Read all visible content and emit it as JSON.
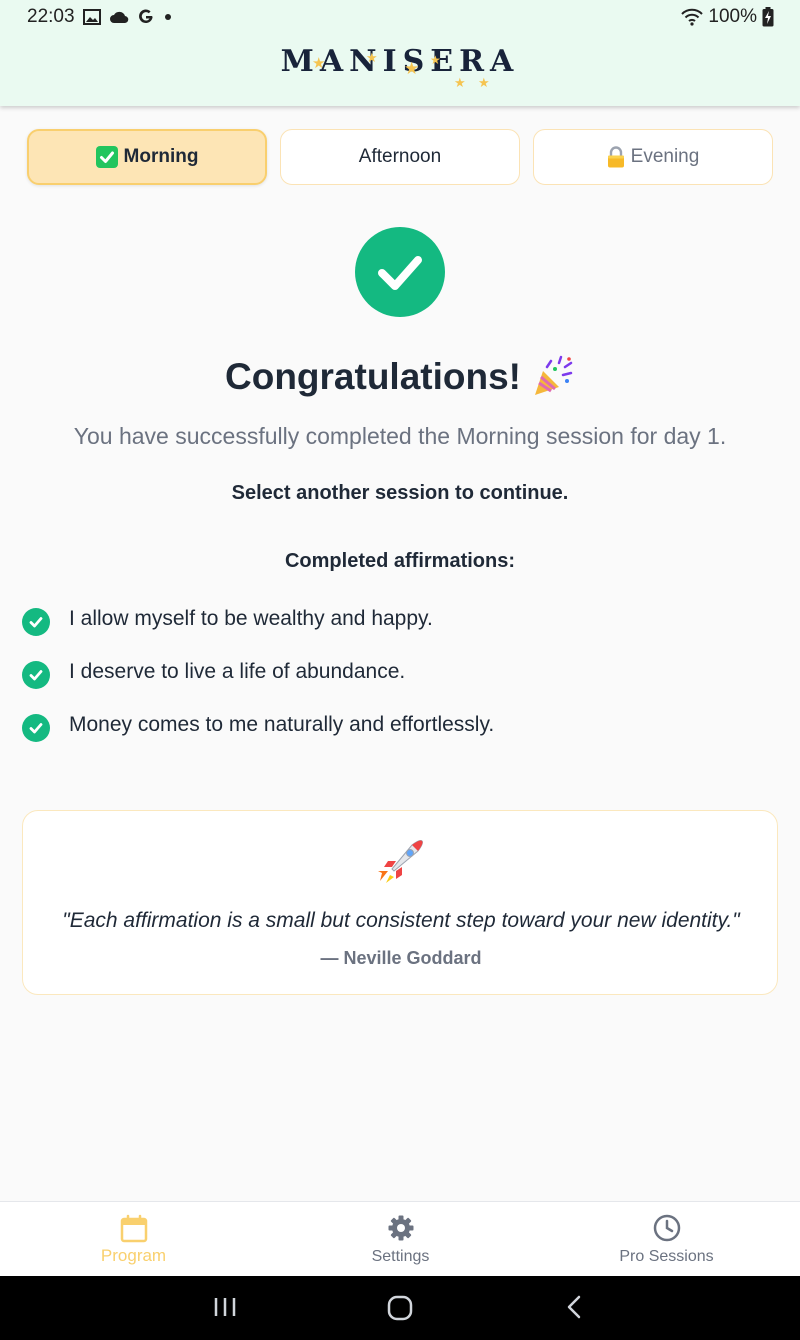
{
  "status_bar": {
    "time": "22:03",
    "battery": "100%"
  },
  "header": {
    "logo": "MANISERA"
  },
  "tabs": [
    {
      "label": "Morning",
      "state": "active",
      "icon": "check-box-icon"
    },
    {
      "label": "Afternoon",
      "state": "default"
    },
    {
      "label": "Evening",
      "state": "locked",
      "icon": "lock-icon"
    }
  ],
  "main": {
    "title": "Congratulations!",
    "title_icon": "party-popper-icon",
    "subtitle": "You have successfully completed the Morning session for day 1.",
    "select_message": "Select another session to continue.",
    "completed_title": "Completed affirmations:",
    "affirmations": [
      "I allow myself to be wealthy and happy.",
      "I deserve to live a life of abundance.",
      "Money comes to me naturally and effortlessly."
    ]
  },
  "quote": {
    "icon": "rocket-icon",
    "text": "\"Each affirmation is a small but consistent step toward your new identity.\"",
    "author": "— Neville Goddard"
  },
  "bottom_nav": [
    {
      "label": "Program",
      "icon": "calendar-icon",
      "active": true
    },
    {
      "label": "Settings",
      "icon": "gear-icon",
      "active": false
    },
    {
      "label": "Pro Sessions",
      "icon": "clock-icon",
      "active": false
    }
  ],
  "colors": {
    "accent": "#f9d06e",
    "success": "#14b981",
    "header_bg": "#eafaf1",
    "active_tab_bg": "#fde5b5"
  }
}
